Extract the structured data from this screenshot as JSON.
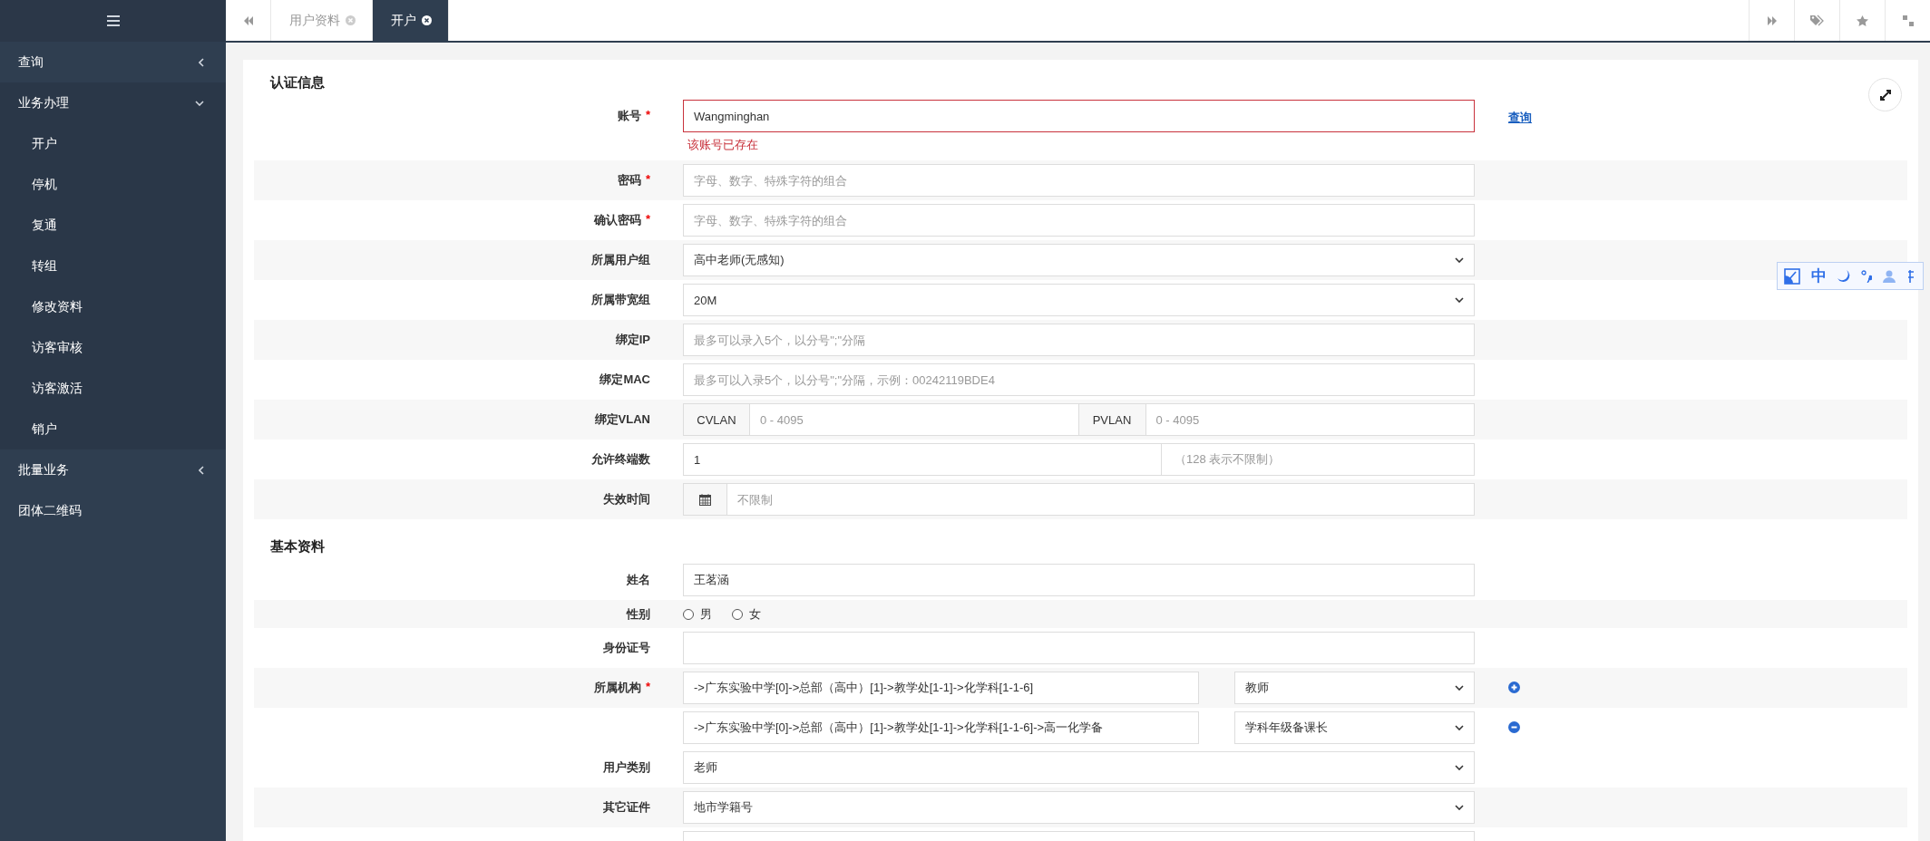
{
  "sidebar": {
    "items": [
      {
        "label": "查询",
        "expanded": false
      },
      {
        "label": "业务办理",
        "expanded": true,
        "children": [
          {
            "label": "开户"
          },
          {
            "label": "停机"
          },
          {
            "label": "复通"
          },
          {
            "label": "转组"
          },
          {
            "label": "修改资料"
          },
          {
            "label": "访客审核"
          },
          {
            "label": "访客激活"
          },
          {
            "label": "销户"
          }
        ]
      },
      {
        "label": "批量业务",
        "expanded": false
      },
      {
        "label": "团体二维码"
      }
    ]
  },
  "tabs": [
    {
      "label": "用户资料",
      "selected": false
    },
    {
      "label": "开户",
      "selected": true
    }
  ],
  "ime_toolbar": {
    "label": "中"
  },
  "sections": [
    {
      "title": "认证信息",
      "rows": [
        {
          "kind": "text",
          "label": "账号",
          "required_mark": "*",
          "value": "Wangminghan",
          "error": "该账号已存在",
          "link": "查询"
        },
        {
          "kind": "text",
          "label": "密码",
          "required_mark": "*",
          "placeholder": "字母、数字、特殊字符的组合"
        },
        {
          "kind": "text",
          "label": "确认密码",
          "required_mark": "*",
          "placeholder": "字母、数字、特殊字符的组合"
        },
        {
          "kind": "select",
          "label": "所属用户组",
          "value": "高中老师(无感知)"
        },
        {
          "kind": "select",
          "label": "所属带宽组",
          "value": "20M"
        },
        {
          "kind": "text",
          "label": "绑定IP",
          "placeholder": "最多可以录入5个，以分号\";\"分隔"
        },
        {
          "kind": "text",
          "label": "绑定MAC",
          "placeholder": "最多可以入录5个，以分号\";\"分隔，示例：00242119BDE4"
        },
        {
          "kind": "vlan",
          "label": "绑定VLAN",
          "parts": [
            {
              "addon": "CVLAN",
              "placeholder": "0 - 4095"
            },
            {
              "addon": "PVLAN",
              "placeholder": "0 - 4095"
            }
          ]
        },
        {
          "kind": "hinted",
          "label": "允许终端数",
          "value": "1",
          "hint": "（128 表示不限制）"
        },
        {
          "kind": "date",
          "label": "失效时间",
          "placeholder": "不限制"
        }
      ]
    },
    {
      "title": "基本资料",
      "rows": [
        {
          "kind": "text",
          "label": "姓名",
          "value": "王茗涵"
        },
        {
          "kind": "radio",
          "label": "性别",
          "options": [
            {
              "label": "男",
              "selected": false
            },
            {
              "label": "女",
              "selected": false
            }
          ]
        },
        {
          "kind": "text",
          "label": "身份证号",
          "value": ""
        },
        {
          "kind": "org",
          "label": "所属机构",
          "required_mark": "*",
          "entries": [
            {
              "path": "->广东实验中学[0]->总部（高中）[1]->教学处[1-1]->化学科[1-1-6]",
              "role": "教师",
              "kind": "add"
            },
            {
              "path": "->广东实验中学[0]->总部（高中）[1]->教学处[1-1]->化学科[1-1-6]->高一化学备",
              "role": "学科年级备课长",
              "kind": "remove"
            }
          ]
        },
        {
          "kind": "select",
          "label": "用户类别",
          "value": "老师"
        },
        {
          "kind": "select",
          "label": "其它证件",
          "value": "地市学籍号"
        },
        {
          "kind": "text",
          "value": ""
        }
      ]
    }
  ]
}
